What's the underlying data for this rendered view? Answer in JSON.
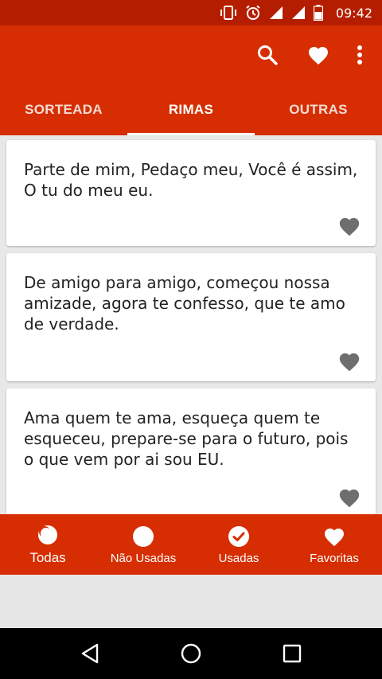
{
  "status_bar": {
    "time": "09:42"
  },
  "colors": {
    "primary": "#d62e02",
    "primary_dark": "#b51d00",
    "card": "#ffffff",
    "heart": "#6e6e6e"
  },
  "app_bar": {
    "actions": [
      {
        "icon": "search-icon"
      },
      {
        "icon": "heart-icon"
      },
      {
        "icon": "more-vert-icon"
      }
    ]
  },
  "tabs": [
    {
      "label": "SORTEADA",
      "selected": false
    },
    {
      "label": "RIMAS",
      "selected": true
    },
    {
      "label": "OUTRAS",
      "selected": false
    }
  ],
  "cards": [
    {
      "text": "Parte de mim, Pedaço meu, Você é assim, O tu do meu eu."
    },
    {
      "text": "De amigo para amigo, começou nossa amizade, agora te confesso, que te amo de verdade."
    },
    {
      "text": "Ama quem te ama, esqueça quem te esqueceu, prepare-se para o futuro, pois o que vem por ai sou EU."
    }
  ],
  "bottom_nav": [
    {
      "label": "Todas",
      "icon": "moon-circle-icon",
      "active": true
    },
    {
      "label": "Não Usadas",
      "icon": "circle-icon",
      "active": false
    },
    {
      "label": "Usadas",
      "icon": "check-circle-icon",
      "active": false
    },
    {
      "label": "Favoritas",
      "icon": "heart-icon",
      "active": false
    }
  ]
}
